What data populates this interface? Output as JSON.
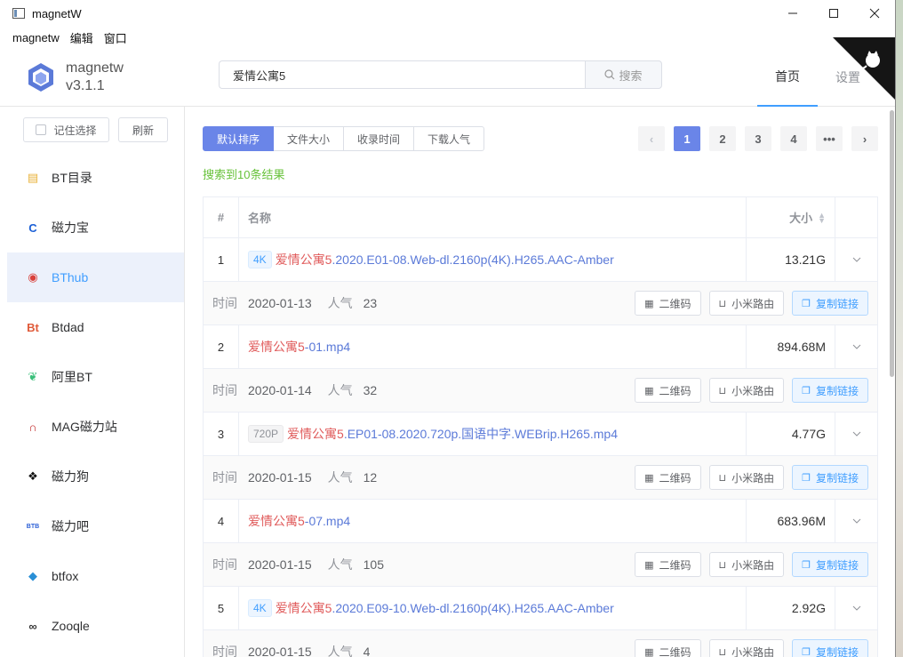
{
  "window": {
    "title": "magnetW",
    "min": "—",
    "max": "☐",
    "close": "✕"
  },
  "menu": [
    "magnetw",
    "编辑",
    "窗口"
  ],
  "brand": {
    "name": "magnetw",
    "version": "v3.1.1"
  },
  "search": {
    "value": "爱情公寓5",
    "button": "搜索"
  },
  "nav": [
    {
      "label": "首页",
      "active": true
    },
    {
      "label": "设置",
      "active": false
    }
  ],
  "sidebar": {
    "remember": "记住选择",
    "refresh": "刷新",
    "items": [
      {
        "label": "BT目录",
        "icon": "book-icon",
        "glyph": "▤",
        "color": "#e8b23a"
      },
      {
        "label": "磁力宝",
        "icon": "c-logo-icon",
        "glyph": "C",
        "color": "#1a5fd6"
      },
      {
        "label": "BThub",
        "icon": "hub-logo-icon",
        "glyph": "◉",
        "color": "#d9403a"
      },
      {
        "label": "Btdad",
        "icon": "bt-logo-icon",
        "glyph": "Bt",
        "color": "#e05b3a"
      },
      {
        "label": "阿里BT",
        "icon": "leaf-icon",
        "glyph": "❦",
        "color": "#3abf7a"
      },
      {
        "label": "MAG磁力站",
        "icon": "magnet-icon",
        "glyph": "∩",
        "color": "#c22b2b"
      },
      {
        "label": "磁力狗",
        "icon": "dog-icon",
        "glyph": "❖",
        "color": "#111111"
      },
      {
        "label": "磁力吧",
        "icon": "btbar-logo-icon",
        "glyph": "BTB",
        "color": "#2b5fd6"
      },
      {
        "label": "btfox",
        "icon": "fox-icon",
        "glyph": "◆",
        "color": "#2a8fd6"
      },
      {
        "label": "Zooqle",
        "icon": "zooqle-icon",
        "glyph": "∞",
        "color": "#333333"
      }
    ]
  },
  "sort": [
    {
      "label": "默认排序",
      "active": true
    },
    {
      "label": "文件大小",
      "active": false
    },
    {
      "label": "收录时间",
      "active": false
    },
    {
      "label": "下载人气",
      "active": false
    }
  ],
  "pager": {
    "prev": "‹",
    "next": "›",
    "pages": [
      "1",
      "2",
      "3",
      "4"
    ],
    "more": "•••",
    "current": "1"
  },
  "result_count": "搜索到10条结果",
  "table": {
    "head": {
      "idx": "#",
      "name": "名称",
      "size": "大小"
    },
    "meta_labels": {
      "time": "时间",
      "pop": "人气"
    },
    "actions": {
      "qr": "二维码",
      "router": "小米路由",
      "copy": "复制链接"
    },
    "rows": [
      {
        "idx": "1",
        "tag": "4K",
        "tag_style": "blue",
        "hl": "爱情公寓5",
        "rest": ".2020.E01-08.Web-dl.2160p(4K).H265.AAC-Amber",
        "size": "13.21G",
        "time": "2020-01-13",
        "pop": "23"
      },
      {
        "idx": "2",
        "tag": "",
        "tag_style": "",
        "hl": "爱情公寓5",
        "rest": "-01.mp4",
        "size": "894.68M",
        "time": "2020-01-14",
        "pop": "32"
      },
      {
        "idx": "3",
        "tag": "720P",
        "tag_style": "gray",
        "hl": "爱情公寓5",
        "rest": ".EP01-08.2020.720p.国语中字.WEBrip.H265.mp4",
        "size": "4.77G",
        "time": "2020-01-15",
        "pop": "12"
      },
      {
        "idx": "4",
        "tag": "",
        "tag_style": "",
        "hl": "爱情公寓5",
        "rest": "-07.mp4",
        "size": "683.96M",
        "time": "2020-01-15",
        "pop": "105"
      },
      {
        "idx": "5",
        "tag": "4K",
        "tag_style": "blue",
        "hl": "爱情公寓5",
        "rest": ".2020.E09-10.Web-dl.2160p(4K).H265.AAC-Amber",
        "size": "2.92G",
        "time": "2020-01-15",
        "pop": "4"
      }
    ]
  }
}
